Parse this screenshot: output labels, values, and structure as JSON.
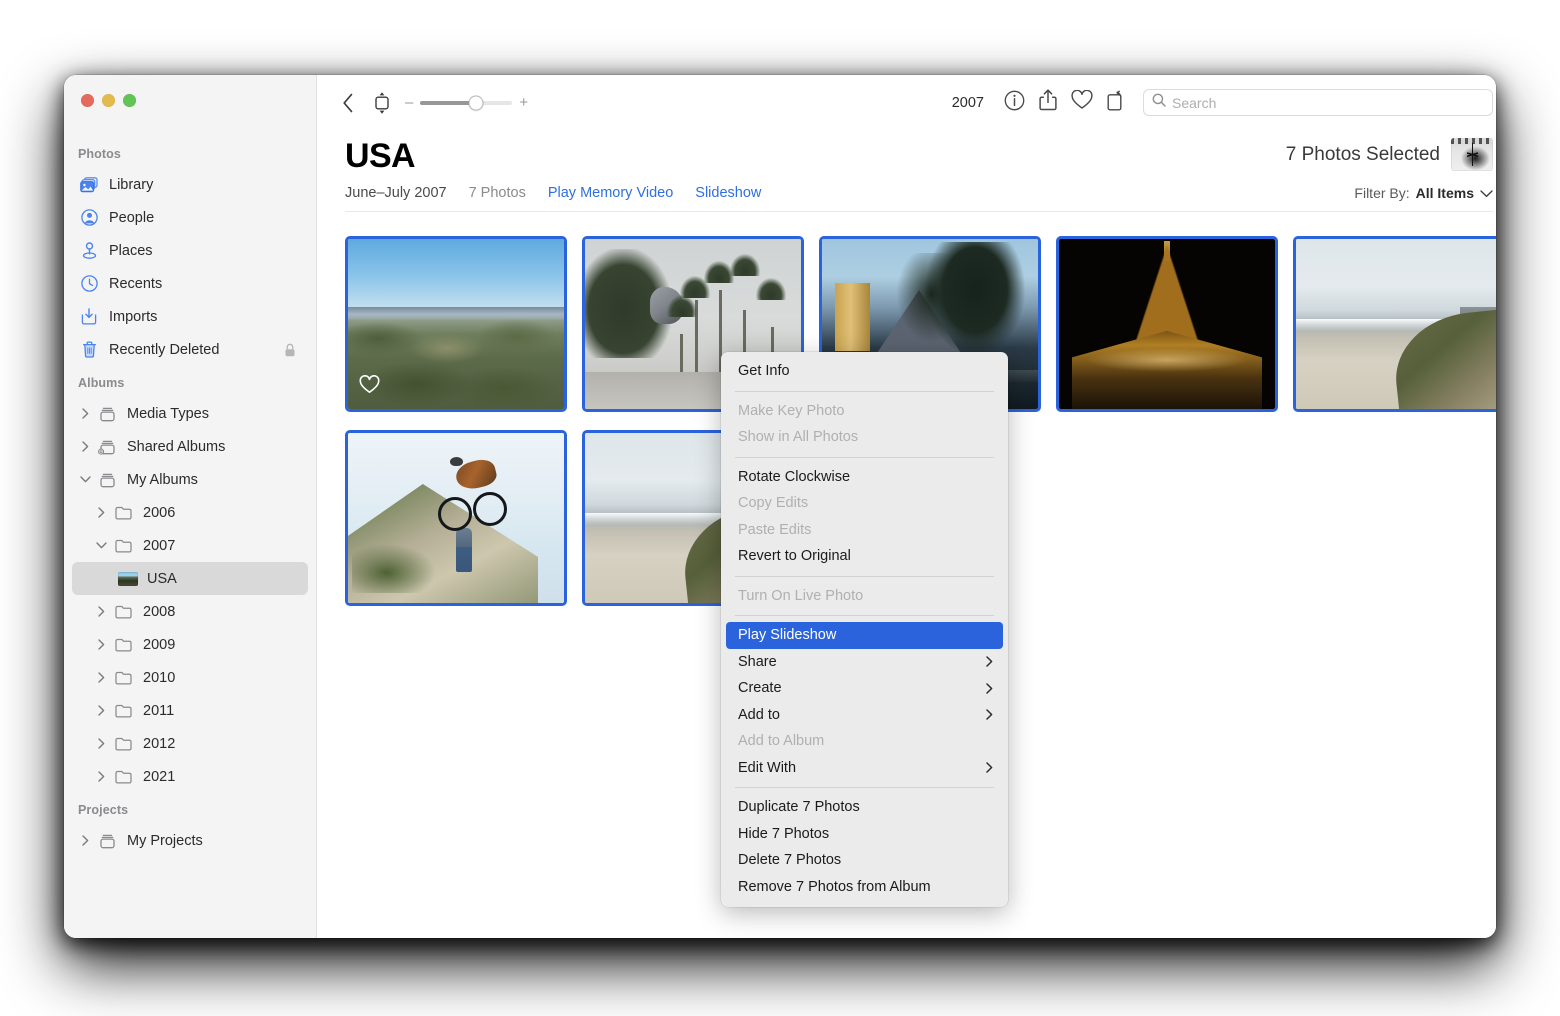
{
  "window": {
    "traffic_lights": [
      {
        "name": "close",
        "color": "#e6695f"
      },
      {
        "name": "minimize",
        "color": "#e3bb4d"
      },
      {
        "name": "zoom",
        "color": "#61c454"
      }
    ]
  },
  "sidebar": {
    "sections": [
      {
        "title": "Photos",
        "items": [
          {
            "label": "Library",
            "icon": "library-icon",
            "level": 1
          },
          {
            "label": "People",
            "icon": "people-icon",
            "level": 1
          },
          {
            "label": "Places",
            "icon": "places-icon",
            "level": 1
          },
          {
            "label": "Recents",
            "icon": "recents-icon",
            "level": 1
          },
          {
            "label": "Imports",
            "icon": "imports-icon",
            "level": 1
          },
          {
            "label": "Recently Deleted",
            "icon": "trash-icon",
            "level": 1,
            "badge": "lock-icon"
          }
        ]
      },
      {
        "title": "Albums",
        "items": [
          {
            "label": "Media Types",
            "icon": "album-stack-icon",
            "level": 1,
            "disclosure": "collapsed"
          },
          {
            "label": "Shared Albums",
            "icon": "shared-album-icon",
            "level": 1,
            "disclosure": "collapsed"
          },
          {
            "label": "My Albums",
            "icon": "album-stack-icon",
            "level": 1,
            "disclosure": "expanded"
          },
          {
            "label": "2006",
            "icon": "folder-icon",
            "level": 2,
            "disclosure": "collapsed"
          },
          {
            "label": "2007",
            "icon": "folder-icon",
            "level": 2,
            "disclosure": "expanded"
          },
          {
            "label": "USA",
            "icon": "album-thumbnail",
            "level": 3,
            "selected": true
          },
          {
            "label": "2008",
            "icon": "folder-icon",
            "level": 2,
            "disclosure": "collapsed"
          },
          {
            "label": "2009",
            "icon": "folder-icon",
            "level": 2,
            "disclosure": "collapsed"
          },
          {
            "label": "2010",
            "icon": "folder-icon",
            "level": 2,
            "disclosure": "collapsed"
          },
          {
            "label": "2011",
            "icon": "folder-icon",
            "level": 2,
            "disclosure": "collapsed"
          },
          {
            "label": "2012",
            "icon": "folder-icon",
            "level": 2,
            "disclosure": "collapsed"
          },
          {
            "label": "2021",
            "icon": "folder-icon",
            "level": 2,
            "disclosure": "collapsed"
          }
        ]
      },
      {
        "title": "Projects",
        "items": [
          {
            "label": "My Projects",
            "icon": "album-stack-icon",
            "level": 1,
            "disclosure": "collapsed"
          }
        ]
      }
    ]
  },
  "toolbar": {
    "back_icon": "chevron-left-icon",
    "aspect_icon": "aspect-ratio-icon",
    "zoom_minus": "–",
    "zoom_plus": "+",
    "zoom_value": 60,
    "year": "2007",
    "icons": [
      "info-icon",
      "share-icon",
      "favorite-icon",
      "rotate-icon"
    ],
    "search": {
      "placeholder": "Search",
      "value": "",
      "icon": "search-icon"
    }
  },
  "header": {
    "title": "USA",
    "date_range": "June–July 2007",
    "photo_count": "7 Photos",
    "links": [
      "Play Memory Video",
      "Slideshow"
    ],
    "selection_text": "7 Photos Selected",
    "filter_label": "Filter By:",
    "filter_value": "All Items",
    "filter_chevron": "chevron-down-icon"
  },
  "grid": {
    "rows": [
      {
        "photos": [
          {
            "name": "photo-hills",
            "art": "ph-hills",
            "favorite": true
          },
          {
            "name": "photo-palms",
            "art": "ph-palms",
            "favorite": false
          },
          {
            "name": "photo-vegas",
            "art": "ph-vegas",
            "favorite": false
          },
          {
            "name": "photo-eiffel",
            "art": "ph-eiffel",
            "favorite": false
          },
          {
            "name": "photo-beach",
            "art": "ph-beach",
            "favorite": false
          }
        ]
      },
      {
        "photos": [
          {
            "name": "photo-biker",
            "art": "ph-biker",
            "favorite": false
          },
          {
            "name": "photo-hidden",
            "art": "ph-beach",
            "favorite": false
          }
        ]
      }
    ]
  },
  "context_menu": {
    "groups": [
      {
        "items": [
          {
            "label": "Get Info",
            "state": "enabled"
          }
        ]
      },
      {
        "items": [
          {
            "label": "Make Key Photo",
            "state": "disabled"
          },
          {
            "label": "Show in All Photos",
            "state": "disabled"
          }
        ]
      },
      {
        "items": [
          {
            "label": "Rotate Clockwise",
            "state": "enabled"
          },
          {
            "label": "Copy Edits",
            "state": "disabled"
          },
          {
            "label": "Paste Edits",
            "state": "disabled"
          },
          {
            "label": "Revert to Original",
            "state": "enabled"
          }
        ]
      },
      {
        "items": [
          {
            "label": "Turn On Live Photo",
            "state": "disabled"
          }
        ]
      },
      {
        "items": [
          {
            "label": "Play Slideshow",
            "state": "highlighted"
          },
          {
            "label": "Share",
            "state": "enabled",
            "submenu": true
          },
          {
            "label": "Create",
            "state": "enabled",
            "submenu": true
          },
          {
            "label": "Add to",
            "state": "enabled",
            "submenu": true
          },
          {
            "label": "Add to Album",
            "state": "disabled"
          },
          {
            "label": "Edit With",
            "state": "enabled",
            "submenu": true
          }
        ]
      },
      {
        "items": [
          {
            "label": "Duplicate 7 Photos",
            "state": "enabled"
          },
          {
            "label": "Hide 7 Photos",
            "state": "enabled"
          },
          {
            "label": "Delete 7 Photos",
            "state": "enabled"
          },
          {
            "label": "Remove 7 Photos from Album",
            "state": "enabled"
          }
        ]
      }
    ]
  },
  "colors": {
    "accent": "#2b63dd",
    "link": "#2f6fe0",
    "sidebar_bg": "#f4f4f4",
    "menu_bg": "#ebebeb",
    "selection_row": "#d9d9d9"
  }
}
